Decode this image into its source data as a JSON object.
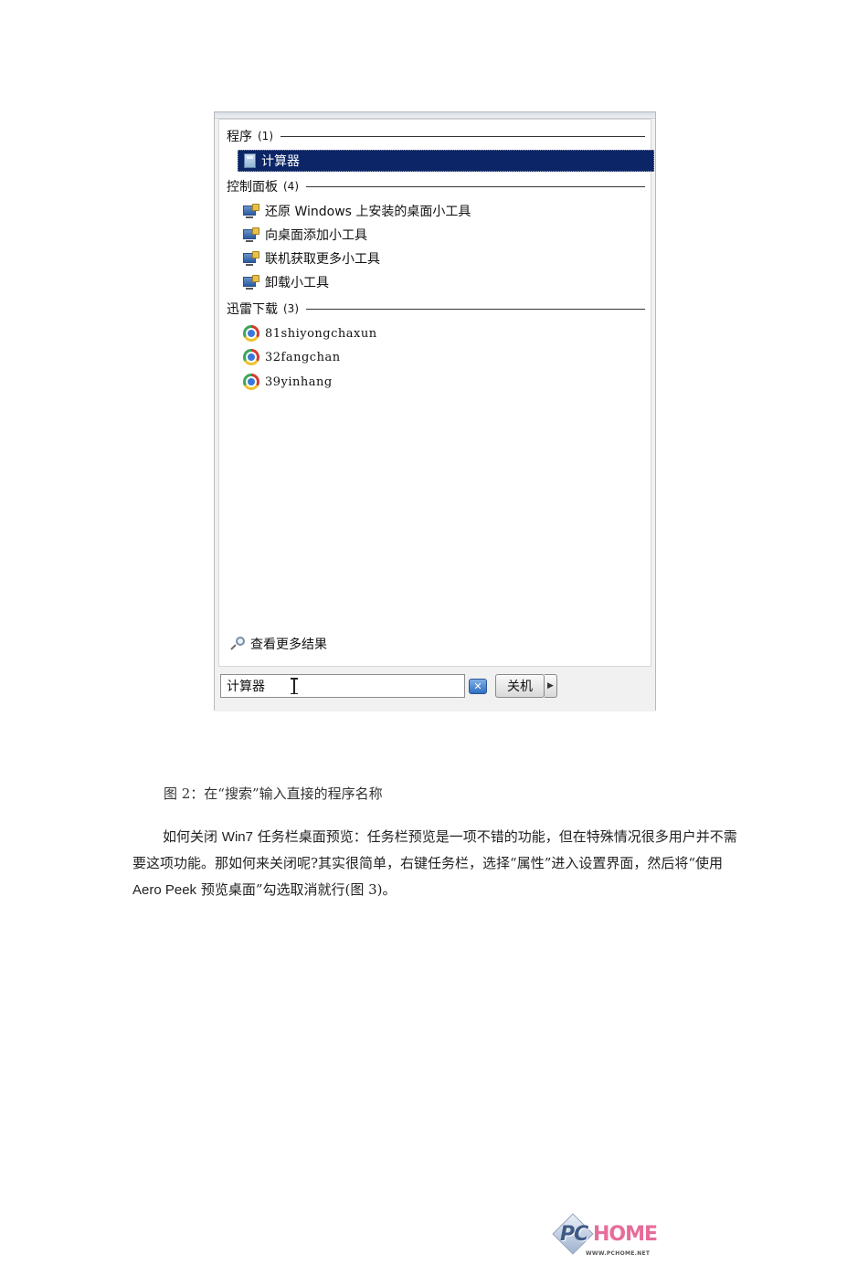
{
  "start_search": {
    "groups": [
      {
        "title": "程序",
        "count": "(1)",
        "items": [
          {
            "label": "计算器",
            "icon": "calculator-icon",
            "selected": true
          }
        ]
      },
      {
        "title": "控制面板",
        "count": "(4)",
        "items": [
          {
            "label": "还原 Windows 上安装的桌面小工具",
            "icon": "control-panel-gadget-icon"
          },
          {
            "label": "向桌面添加小工具",
            "icon": "control-panel-gadget-icon"
          },
          {
            "label": "联机获取更多小工具",
            "icon": "control-panel-gadget-icon"
          },
          {
            "label": "卸载小工具",
            "icon": "control-panel-gadget-icon"
          }
        ]
      },
      {
        "title": "迅雷下载",
        "count": "(3)",
        "items": [
          {
            "label": "81shiyongchaxun",
            "icon": "chrome-icon"
          },
          {
            "label": "32fangchan",
            "icon": "chrome-icon"
          },
          {
            "label": "39yinhang",
            "icon": "chrome-icon"
          }
        ]
      }
    ],
    "see_more": "查看更多结果",
    "search_value": "计算器",
    "clear_icon": "clear-x-icon",
    "shutdown_label": "关机",
    "shutdown_arrow": "▶",
    "watermark": {
      "pc": "PC",
      "home": "HOME",
      "url": "WWW.PCHOME.NET"
    }
  },
  "caption": "图 2：在“搜索”输入直接的程序名称",
  "paragraph": {
    "p1": "如何关闭 ",
    "p2": "Win7",
    "p3": " 任务栏桌面预览：任务栏预览是一项不错的功能，但在特殊情况很多用户并不需要这项功能。那如何来关闭呢?其实很简单，右键任务栏，选择“属性”进入设置界面，然后将“使用 ",
    "p4": "Aero Peek",
    "p5": " 预览桌面”勾选取消就行(",
    "p6": "图 3)。"
  }
}
